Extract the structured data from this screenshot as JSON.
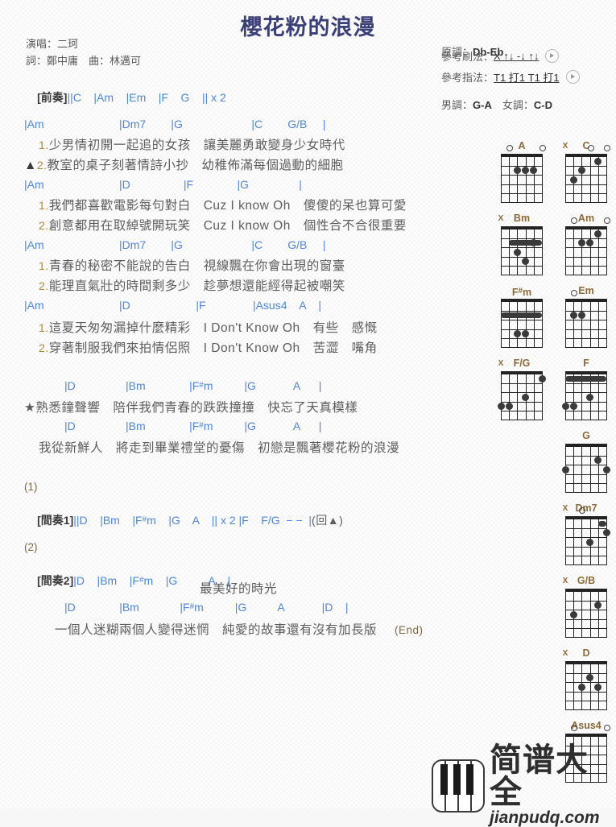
{
  "header": {
    "title": "櫻花粉的浪漫",
    "singer_line": "演唱：二珂",
    "credit_line": "詞：鄭中庸　曲：林邁可",
    "original_key_label": "原調：",
    "original_key": "Db-Eb",
    "male_key_label": "男調：",
    "male_key": "G-A",
    "female_key_label": "　女調：",
    "female_key": "C-D",
    "strum_label": "參考刷法：",
    "strum_pattern": "X ↑↓ -↓ ↑↓",
    "finger_label": "參考指法：",
    "finger_pattern": "T1 打1 T1 打1",
    "play_icon": "play-icon"
  },
  "intro": {
    "label": "[前奏]",
    "chords": "||C    |Am    |Em    |F    G    || x 2"
  },
  "sections": [
    {
      "chords": "|Am                        |Dm7        |G                      |C        G/B     |",
      "lyrics": [
        {
          "num": "1.",
          "prefix": "",
          "text": "少男情初開一起追的女孩　讓美麗勇敢變身少女時代"
        },
        {
          "num": "2.",
          "prefix": "▲",
          "text": "教室的桌子刻著情詩小抄　幼稚佈滿每個過動的細胞"
        }
      ]
    },
    {
      "chords": "|Am                        |D                 |F              |G                |",
      "lyrics": [
        {
          "num": "1.",
          "prefix": "",
          "text": "我們都喜歡電影每句對白　Cuz I know Oh　傻傻的呆也算可愛"
        },
        {
          "num": "2.",
          "prefix": "",
          "text": "創意都用在取綽號開玩笑　Cuz I know Oh　個性合不合很重要"
        }
      ]
    },
    {
      "chords": "|Am                        |Dm7        |G                      |C        G/B     |",
      "lyrics": [
        {
          "num": "1.",
          "prefix": "",
          "text": "青春的秘密不能說的告白　視線飄在你會出現的窗臺"
        },
        {
          "num": "2.",
          "prefix": "",
          "text": "能理直氣壯的時間剩多少　趁夢想還能經得起被嘲笑"
        }
      ]
    },
    {
      "chords": "|Am                        |D                     |F               |Asus4    A    |",
      "lyrics": [
        {
          "num": "1.",
          "prefix": "",
          "text": "這夏天匆匆漏掉什麼精彩　I Don't Know Oh　有些　感慨"
        },
        {
          "num": "2.",
          "prefix": "",
          "text": "穿著制服我們來拍情侶照　I Don't Know Oh　苦澀　嘴角"
        }
      ]
    }
  ],
  "chorus": [
    {
      "chords": "|D                |Bm              |F#m          |G            A      |",
      "lyric": "★熟悉鐘聲響　陪伴我們青春的跌跌撞撞　快忘了天真模樣"
    },
    {
      "chords": "|D                |Bm              |F#m          |G            A      |",
      "lyric": "我從新鮮人　將走到畢業禮堂的憂傷　初戀是飄著櫻花粉的浪漫"
    }
  ],
  "interlude1": {
    "marker": "(1)",
    "label": "[間奏1]",
    "chords": "||D    |Bm    |F#m    |G    A    || x 2 |F    F/G  − −  |",
    "repeat_note": "(回▲)"
  },
  "interlude2": {
    "marker": "(2)",
    "label": "[間奏2]",
    "chords": "|D    |Bm    |F#m    |G          A    |",
    "lyric": "最美好的時光"
  },
  "ending": {
    "chords": "|D              |Bm             |F#m          |G          A            |D    |",
    "lyric": "一個人迷糊兩個人變得迷惘　純愛的故事還有沒有加長版",
    "end_note": "(End)"
  },
  "chord_diagrams": [
    {
      "name": "A",
      "markers": [
        "o",
        "",
        "",
        "",
        "o",
        ""
      ],
      "dots": [
        {
          "s": 2,
          "f": 2
        },
        {
          "s": 3,
          "f": 2
        },
        {
          "s": 4,
          "f": 2
        }
      ],
      "barre": null
    },
    {
      "name": "C",
      "markers": [
        "o",
        "",
        "o",
        "",
        "",
        "X"
      ],
      "dots": [
        {
          "s": 2,
          "f": 1
        },
        {
          "s": 4,
          "f": 2
        },
        {
          "s": 5,
          "f": 3
        }
      ],
      "barre": null
    },
    {
      "name": "Bm",
      "markers": [
        "",
        "",
        "",
        "",
        "",
        "X"
      ],
      "dots": [
        {
          "s": 3,
          "f": 4
        },
        {
          "s": 4,
          "f": 3
        },
        {
          "s": 2,
          "f": 2
        }
      ],
      "barre": {
        "f": 2,
        "from": 1,
        "to": 5
      }
    },
    {
      "name": "Am",
      "markers": [
        "o",
        "",
        "",
        "",
        "o",
        ""
      ],
      "dots": [
        {
          "s": 2,
          "f": 1
        },
        {
          "s": 3,
          "f": 2
        },
        {
          "s": 4,
          "f": 2
        }
      ],
      "barre": null
    },
    {
      "name": "F#m",
      "markers": [
        "",
        "",
        "",
        "",
        "",
        ""
      ],
      "dots": [
        {
          "s": 3,
          "f": 4
        },
        {
          "s": 4,
          "f": 4
        }
      ],
      "barre": {
        "f": 2,
        "from": 1,
        "to": 6
      }
    },
    {
      "name": "Em",
      "markers": [
        "",
        "",
        "",
        "",
        "o",
        ""
      ],
      "dots": [
        {
          "s": 4,
          "f": 2
        },
        {
          "s": 5,
          "f": 2
        }
      ],
      "barre": null
    },
    {
      "name": "F/G",
      "markers": [
        "",
        "",
        "",
        "",
        "",
        "X"
      ],
      "dots": [
        {
          "s": 1,
          "f": 1
        },
        {
          "s": 3,
          "f": 3
        },
        {
          "s": 5,
          "f": 4
        },
        {
          "s": 6,
          "f": 4
        }
      ],
      "barre": null
    },
    {
      "name": "F",
      "markers": [
        "",
        "",
        "",
        "",
        "",
        ""
      ],
      "dots": [
        {
          "s": 3,
          "f": 3
        },
        {
          "s": 5,
          "f": 4
        },
        {
          "s": 6,
          "f": 4
        }
      ],
      "barre": {
        "f": 1,
        "from": 1,
        "to": 6
      }
    },
    {
      "name": "G",
      "markers": [
        "",
        "",
        "",
        "",
        "",
        ""
      ],
      "dots": [
        {
          "s": 1,
          "f": 3
        },
        {
          "s": 2,
          "f": 2
        },
        {
          "s": 6,
          "f": 3
        }
      ],
      "barre": null
    },
    {
      "name": "Dm7",
      "markers": [
        "",
        "",
        "",
        "o",
        "",
        "X"
      ],
      "dots": [
        {
          "s": 3,
          "f": 3
        },
        {
          "s": 1,
          "f": 2
        }
      ],
      "barre": {
        "f": 1,
        "from": 1,
        "to": 2
      }
    },
    {
      "name": "G/B",
      "markers": [
        "",
        "",
        "",
        "",
        "",
        "X"
      ],
      "dots": [
        {
          "s": 2,
          "f": 2
        },
        {
          "s": 5,
          "f": 3
        }
      ],
      "barre": null
    },
    {
      "name": "D",
      "markers": [
        "",
        "",
        "",
        "",
        "",
        "X"
      ],
      "dots": [
        {
          "s": 2,
          "f": 3
        },
        {
          "s": 3,
          "f": 2
        },
        {
          "s": 4,
          "f": 3
        }
      ],
      "barre": null
    },
    {
      "name": "Asus4",
      "markers": [
        "o",
        "",
        "",
        "",
        "o",
        ""
      ],
      "dots": [],
      "barre": null
    }
  ],
  "watermark": {
    "cn": "简谱大全",
    "en": "jianpudq.com",
    "icon": "piano-keys-icon"
  }
}
